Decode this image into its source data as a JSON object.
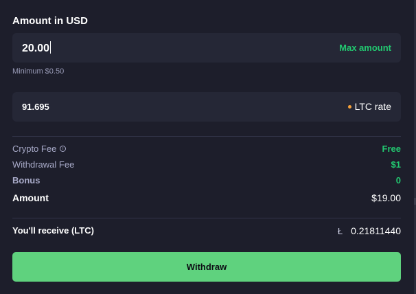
{
  "amount": {
    "label": "Amount in USD",
    "value": "20.00",
    "max_label": "Max amount",
    "minimum_hint": "Minimum $0.50"
  },
  "rate": {
    "value": "91.695",
    "label": "LTC rate",
    "dot_color": "#f6a13a"
  },
  "summary": {
    "crypto_fee": {
      "label": "Crypto Fee",
      "value": "Free",
      "icon": "info-icon"
    },
    "withdrawal_fee": {
      "label": "Withdrawal Fee",
      "value": "$1"
    },
    "bonus": {
      "label": "Bonus",
      "value": "0"
    },
    "amount": {
      "label": "Amount",
      "value": "$19.00"
    }
  },
  "receive": {
    "label": "You'll receive (LTC)",
    "icon": "litecoin-icon",
    "value": "0.21811440"
  },
  "withdraw_button": {
    "label": "Withdraw"
  },
  "colors": {
    "background": "#1d1e2b",
    "field": "#252736",
    "accent_green": "#22c870",
    "button_green": "#5fd27e"
  }
}
